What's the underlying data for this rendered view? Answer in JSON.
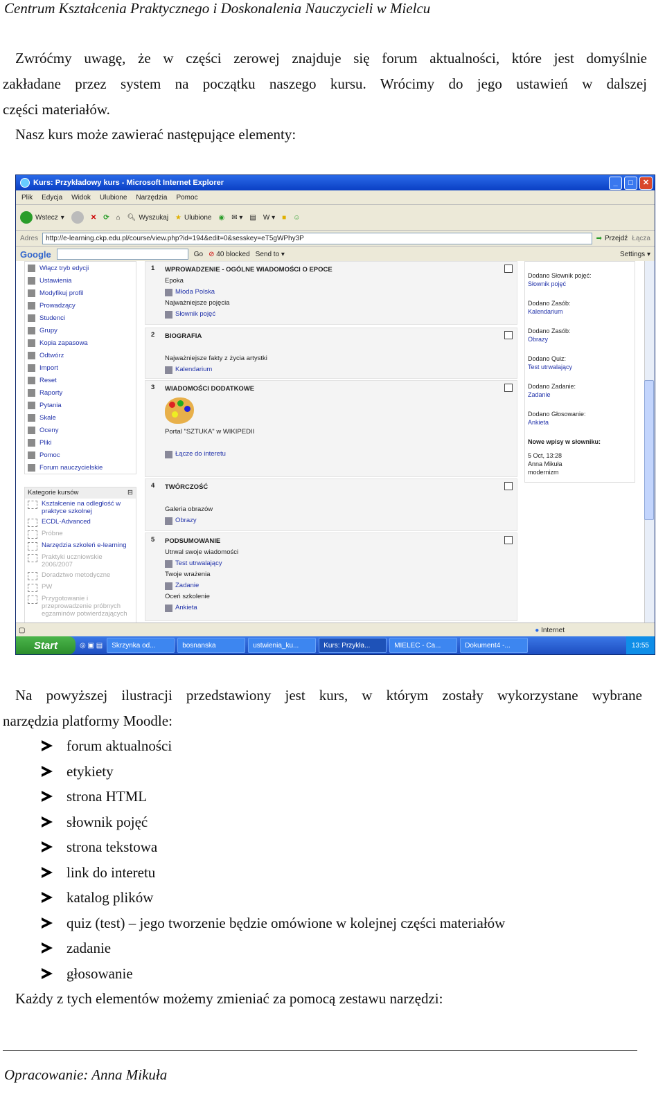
{
  "header": "Centrum Kształcenia Praktycznego i Doskonalenia Nauczycieli w Mielcu",
  "intro": {
    "line1": "Zwróćmy uwagę, że w części zerowej znajduje się forum aktualności, które jest domyślnie",
    "line2": "zakładane przez system na początku naszego kursu. Wrócimy do jego ustawień w dalszej",
    "line3": "części materiałów.",
    "line4": "Nasz kurs może zawierać następujące elementy:"
  },
  "screenshot": {
    "window_title": "Kurs: Przykładowy kurs - Microsoft Internet Explorer",
    "menu": [
      "Plik",
      "Edycja",
      "Widok",
      "Ulubione",
      "Narzędzia",
      "Pomoc"
    ],
    "toolbar": {
      "back": "Wstecz",
      "search": "Wyszukaj",
      "favorites": "Ulubione"
    },
    "address_label": "Adres",
    "address": "http://e-learning.ckp.edu.pl/course/view.php?id=194&edit=0&sesskey=eT5gWPhy3P",
    "go": "Przejdź",
    "links": "Łącza",
    "google": {
      "logo": "Google",
      "go": "Go",
      "blocked": "40 blocked",
      "send": "Send to",
      "settings": "Settings"
    },
    "admin_items": [
      "Włącz tryb edycji",
      "Ustawienia",
      "Modyfikuj profil",
      "Prowadzący",
      "Studenci",
      "Grupy",
      "Kopia zapasowa",
      "Odtwórz",
      "Import",
      "Reset",
      "Raporty",
      "Pytania",
      "Skale",
      "Oceny",
      "Pliki",
      "Pomoc",
      "Forum nauczycielskie"
    ],
    "categories": {
      "title": "Kategorie kursów",
      "items": [
        {
          "label": "Kształcenie na odległość w praktyce szkolnej",
          "dim": false
        },
        {
          "label": "ECDL-Advanced",
          "dim": false
        },
        {
          "label": "Próbne",
          "dim": true
        },
        {
          "label": "Narzędzia szkoleń e-learning",
          "dim": false
        },
        {
          "label": "Praktyki uczniowskie 2006/2007",
          "dim": true
        },
        {
          "label": "Doradztwo metodyczne",
          "dim": true
        },
        {
          "label": "PW",
          "dim": true
        },
        {
          "label": "Przygotowanie i przeprowadzenie próbnych egzaminów potwierdzających",
          "dim": true
        }
      ]
    },
    "sections": [
      {
        "num": "1",
        "title": "WPROWADZENIE - OGÓLNE WIADOMOŚCI O EPOCE",
        "lines": [
          {
            "t": "Epoka",
            "link": false
          },
          {
            "t": "Młoda Polska",
            "link": true
          },
          {
            "t": "Najważniejsze pojęcia",
            "link": false
          },
          {
            "t": "Słownik pojęć",
            "link": true
          }
        ]
      },
      {
        "num": "2",
        "title": "BIOGRAFIA",
        "lines": [
          {
            "t": "",
            "link": false
          },
          {
            "t": "Najważniejsze fakty z życia artystki",
            "link": false
          },
          {
            "t": "Kalendarium",
            "link": true
          }
        ]
      },
      {
        "num": "3",
        "title": "WIADOMOŚCI DODATKOWE",
        "lines": [
          {
            "t": "Portal \"SZTUKA\" w WIKIPEDII",
            "link": false
          },
          {
            "t": "",
            "link": false
          },
          {
            "t": "Łącze do interetu",
            "link": true
          }
        ]
      },
      {
        "num": "4",
        "title": "TWÓRCZOŚĆ",
        "lines": [
          {
            "t": "",
            "link": false
          },
          {
            "t": "Galeria obrazów",
            "link": false
          },
          {
            "t": "Obrazy",
            "link": true
          }
        ]
      },
      {
        "num": "5",
        "title": "PODSUMOWANIE",
        "lines": [
          {
            "t": "Utrwal swoje wiadomości",
            "link": false
          },
          {
            "t": "Test utrwalający",
            "link": true
          },
          {
            "t": "Twoje wrażenia",
            "link": false
          },
          {
            "t": "Zadanie",
            "link": true
          },
          {
            "t": "Oceń szkolenie",
            "link": false
          },
          {
            "t": "Ankieta",
            "link": true
          }
        ]
      }
    ],
    "recent": [
      {
        "a": "Dodano Słownik pojęć:",
        "b": "Słownik pojęć"
      },
      {
        "a": "Dodano Zasób:",
        "b": "Kalendarium"
      },
      {
        "a": "Dodano Zasób:",
        "b": "Obrazy"
      },
      {
        "a": "Dodano Quiz:",
        "b": "Test utrwalający"
      },
      {
        "a": "Dodano Zadanie:",
        "b": "Zadanie"
      },
      {
        "a": "Dodano Głosowanie:",
        "b": "Ankieta"
      }
    ],
    "glossary": {
      "title": "Nowe wpisy w słowniku:",
      "date": "5 Oct, 13:28",
      "author": "Anna Mikuła",
      "word": "modernizm"
    },
    "status": "Internet",
    "taskbar": {
      "start": "Start",
      "tasks": [
        "Skrzynka od...",
        "bosnanska",
        "ustwienia_ku...",
        "Kurs: Przykła...",
        "MIELEC - Ca...",
        "Dokument4 -..."
      ],
      "clock": "13:55"
    }
  },
  "para2": {
    "line1": "Na powyższej ilustracji przedstawiony jest kurs, w którym zostały wykorzystane wybrane",
    "line2": "narzędzia platformy Moodle:"
  },
  "list": [
    "forum aktualności",
    "etykiety",
    "strona HTML",
    "słownik pojęć",
    "strona tekstowa",
    "link do interetu",
    "katalog plików",
    "quiz (test) – jego tworzenie będzie omówione w kolejnej części materiałów",
    "zadanie",
    "głosowanie"
  ],
  "closing": "Każdy z tych elementów możemy zmieniać za pomocą zestawu narzędzi:",
  "footer": "Opracowanie: Anna Mikuła"
}
